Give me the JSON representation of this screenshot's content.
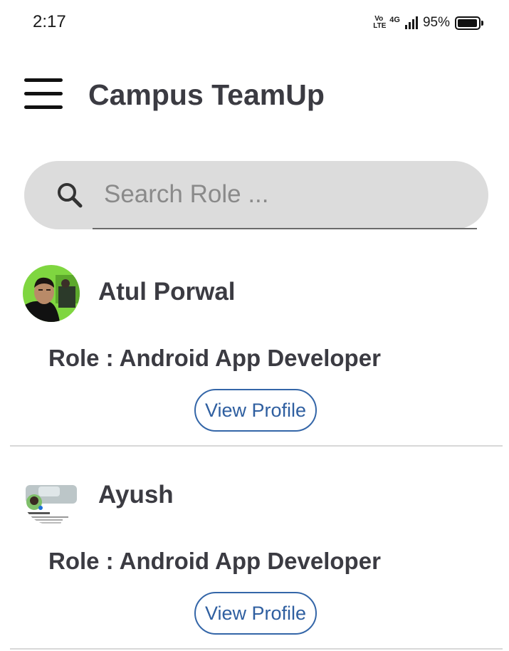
{
  "status_bar": {
    "time": "2:17",
    "volte": "Vo LTE",
    "network": "4G",
    "battery_percent": "95%",
    "battery_level": 0.95
  },
  "app_bar": {
    "title": "Campus TeamUp",
    "menu_icon": "hamburger-menu-icon"
  },
  "search": {
    "placeholder": "Search Role ...",
    "value": "",
    "icon": "search-icon"
  },
  "members": [
    {
      "name": "Atul Porwal",
      "role": "Role : Android App Developer",
      "button_label": "View Profile"
    },
    {
      "name": "Ayush",
      "role": "Role : Android App Developer",
      "button_label": "View Profile"
    }
  ],
  "colors": {
    "accent": "#3466a8",
    "text_dark": "#3b3b42",
    "search_bg": "#dcdcdc"
  }
}
